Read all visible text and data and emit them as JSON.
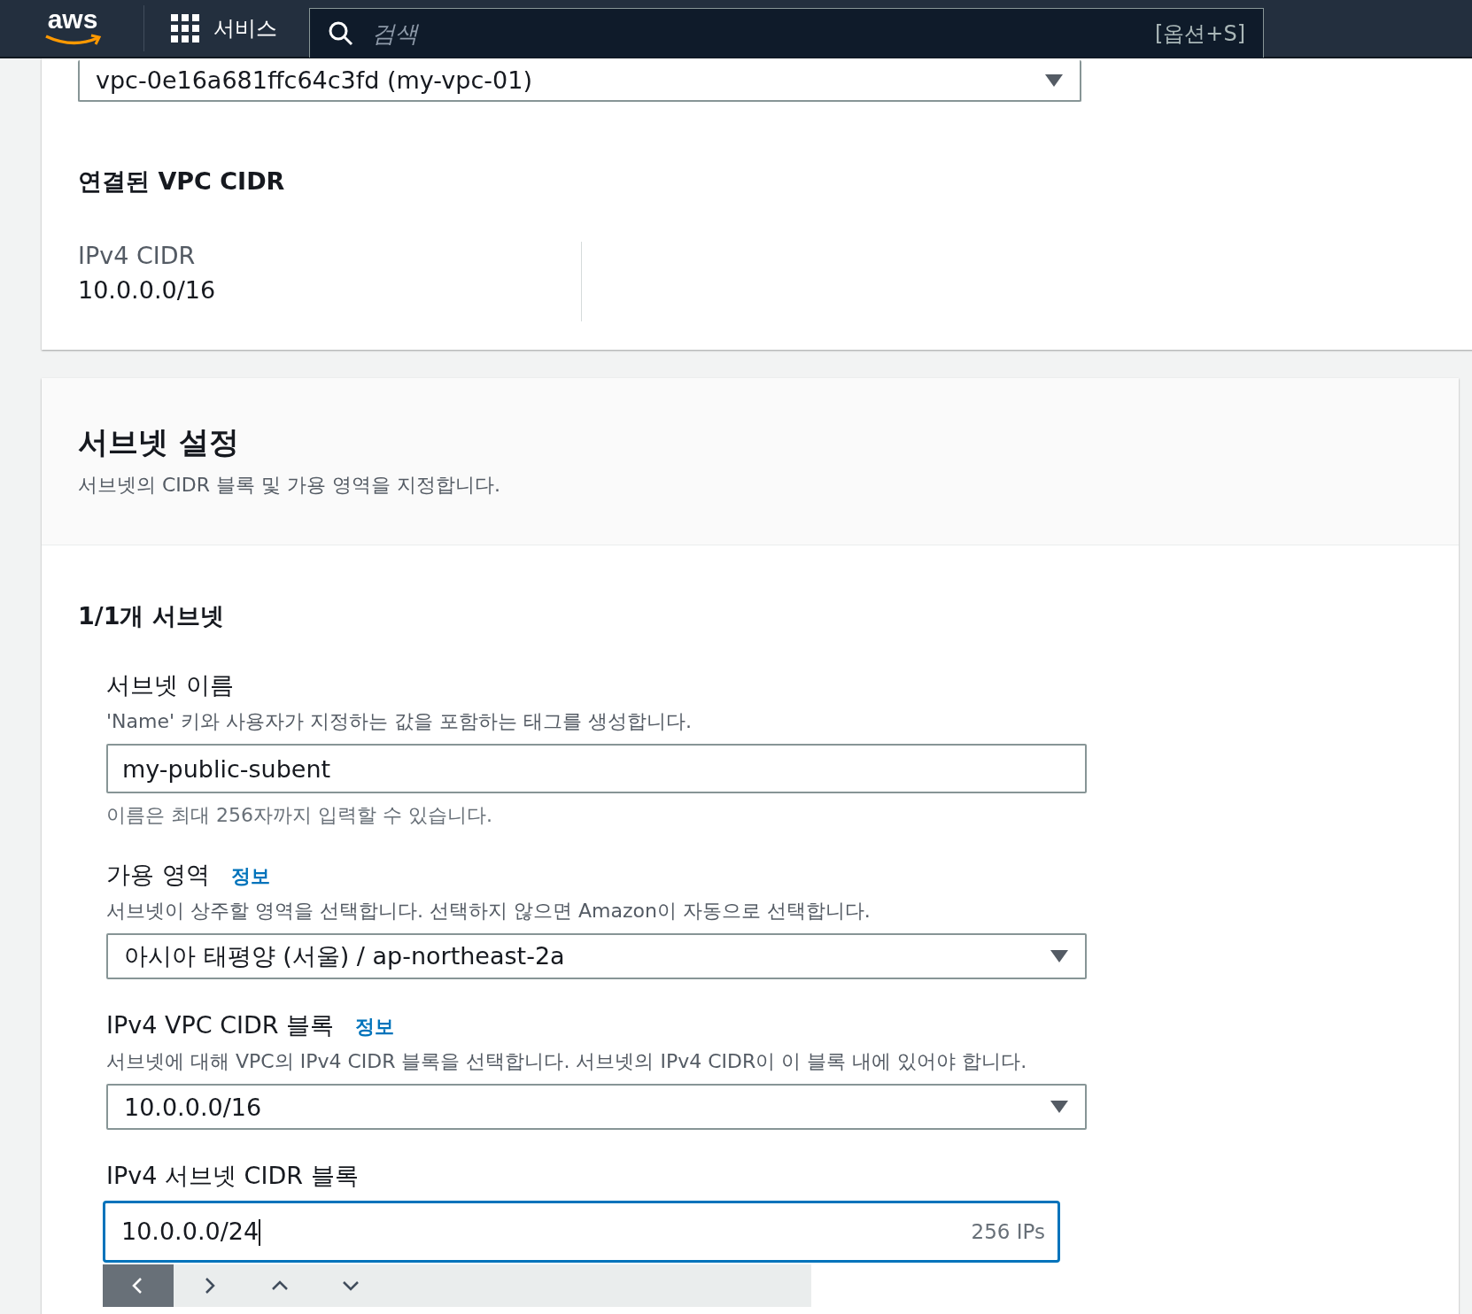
{
  "top_nav": {
    "logo": "aws",
    "services": "서비스",
    "search": {
      "placeholder": "검색",
      "shortcut": "[옵션+S]"
    }
  },
  "vpc_select": {
    "value": "vpc-0e16a681ffc64c3fd (my-vpc-01)"
  },
  "vpc_cidr": {
    "title": "연결된 VPC CIDR",
    "label": "IPv4 CIDR",
    "value": "10.0.0.0/16"
  },
  "subnet_settings": {
    "title": "서브넷 설정",
    "description": "서브넷의 CIDR 블록 및 가용 영역을 지정합니다.",
    "subnet_heading": "1/1개 서브넷",
    "fields": [
      {
        "kind": "input",
        "label": "서브넷 이름",
        "description": "'Name' 키와 사용자가 지정하는 값을 포함하는 태그를 생성합니다.",
        "value": "my-public-subent",
        "hint": "이름은 최대 256자까지 입력할 수 있습니다."
      },
      {
        "kind": "select",
        "label": "가용 영역",
        "info": "정보",
        "description": "서브넷이 상주할 영역을 선택합니다. 선택하지 않으면 Amazon이 자동으로 선택합니다.",
        "value": "아시아 태평양 (서울) / ap-northeast-2a"
      },
      {
        "kind": "select",
        "label": "IPv4 VPC CIDR 블록",
        "info": "정보",
        "description": "서브넷에 대해 VPC의 IPv4 CIDR 블록을 선택합니다. 서브넷의 IPv4 CIDR이 이 블록 내에 있어야 합니다.",
        "value": "10.0.0.0/16"
      },
      {
        "kind": "cidr",
        "label": "IPv4 서브넷 CIDR 블록",
        "value": "10.0.0.0/24",
        "focused": true,
        "suffix": "256 IPs"
      }
    ]
  },
  "keyboard_toolbar": {
    "buttons": [
      {
        "kind": "left",
        "selected": true
      },
      {
        "kind": "right",
        "selected": false
      },
      {
        "kind": "up",
        "selected": false
      },
      {
        "kind": "down",
        "selected": false
      }
    ]
  }
}
